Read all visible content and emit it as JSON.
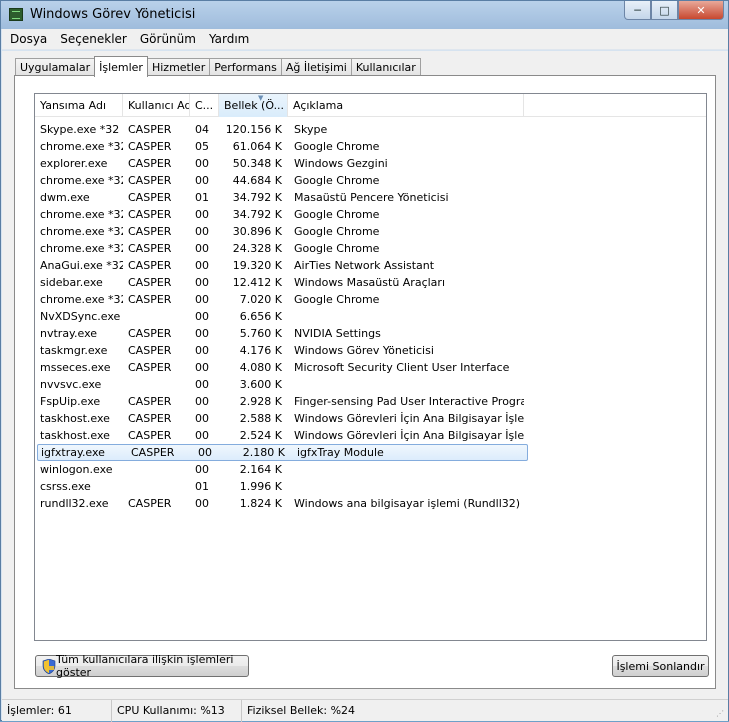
{
  "window": {
    "title": "Windows Görev Yöneticisi"
  },
  "caption_buttons": {
    "minimize": "─",
    "maximize": "□",
    "close": "✕"
  },
  "menu": [
    "Dosya",
    "Seçenekler",
    "Görünüm",
    "Yardım"
  ],
  "tabs": [
    "Uygulamalar",
    "İşlemler",
    "Hizmetler",
    "Performans",
    "Ağ İletişimi",
    "Kullanıcılar"
  ],
  "active_tab": "İşlemler",
  "columns": [
    "Yansıma Adı",
    "Kullanıcı Adı",
    "C...",
    "Bellek (Ö...",
    "Açıklama"
  ],
  "sorted_column": "Bellek (Ö...",
  "processes": [
    {
      "name": "Skype.exe *32",
      "user": "CASPER",
      "cpu": "04",
      "mem": "120.156 K",
      "desc": "Skype"
    },
    {
      "name": "chrome.exe *32",
      "user": "CASPER",
      "cpu": "05",
      "mem": "61.064 K",
      "desc": "Google Chrome"
    },
    {
      "name": "explorer.exe",
      "user": "CASPER",
      "cpu": "00",
      "mem": "50.348 K",
      "desc": "Windows Gezgini"
    },
    {
      "name": "chrome.exe *32",
      "user": "CASPER",
      "cpu": "00",
      "mem": "44.684 K",
      "desc": "Google Chrome"
    },
    {
      "name": "dwm.exe",
      "user": "CASPER",
      "cpu": "01",
      "mem": "34.792 K",
      "desc": "Masaüstü Pencere Yöneticisi"
    },
    {
      "name": "chrome.exe *32",
      "user": "CASPER",
      "cpu": "00",
      "mem": "34.792 K",
      "desc": "Google Chrome"
    },
    {
      "name": "chrome.exe *32",
      "user": "CASPER",
      "cpu": "00",
      "mem": "30.896 K",
      "desc": "Google Chrome"
    },
    {
      "name": "chrome.exe *32",
      "user": "CASPER",
      "cpu": "00",
      "mem": "24.328 K",
      "desc": "Google Chrome"
    },
    {
      "name": "AnaGui.exe *32",
      "user": "CASPER",
      "cpu": "00",
      "mem": "19.320 K",
      "desc": "AirTies Network Assistant"
    },
    {
      "name": "sidebar.exe",
      "user": "CASPER",
      "cpu": "00",
      "mem": "12.412 K",
      "desc": "Windows Masaüstü Araçları"
    },
    {
      "name": "chrome.exe *32",
      "user": "CASPER",
      "cpu": "00",
      "mem": "7.020 K",
      "desc": "Google Chrome"
    },
    {
      "name": "NvXDSync.exe",
      "user": "",
      "cpu": "00",
      "mem": "6.656 K",
      "desc": ""
    },
    {
      "name": "nvtray.exe",
      "user": "CASPER",
      "cpu": "00",
      "mem": "5.760 K",
      "desc": "NVIDIA Settings"
    },
    {
      "name": "taskmgr.exe",
      "user": "CASPER",
      "cpu": "00",
      "mem": "4.176 K",
      "desc": "Windows Görev Yöneticisi"
    },
    {
      "name": "msseces.exe",
      "user": "CASPER",
      "cpu": "00",
      "mem": "4.080 K",
      "desc": "Microsoft Security Client User Interface"
    },
    {
      "name": "nvvsvc.exe",
      "user": "",
      "cpu": "00",
      "mem": "3.600 K",
      "desc": ""
    },
    {
      "name": "FspUip.exe",
      "user": "CASPER",
      "cpu": "00",
      "mem": "2.928 K",
      "desc": "Finger-sensing Pad User Interactive Program"
    },
    {
      "name": "taskhost.exe",
      "user": "CASPER",
      "cpu": "00",
      "mem": "2.588 K",
      "desc": "Windows Görevleri İçin Ana Bilgisayar İşlemi"
    },
    {
      "name": "taskhost.exe",
      "user": "CASPER",
      "cpu": "00",
      "mem": "2.524 K",
      "desc": "Windows Görevleri İçin Ana Bilgisayar İşlemi"
    },
    {
      "name": "igfxtray.exe",
      "user": "CASPER",
      "cpu": "00",
      "mem": "2.180 K",
      "desc": "igfxTray Module",
      "selected": true
    },
    {
      "name": "winlogon.exe",
      "user": "",
      "cpu": "00",
      "mem": "2.164 K",
      "desc": ""
    },
    {
      "name": "csrss.exe",
      "user": "",
      "cpu": "01",
      "mem": "1.996 K",
      "desc": ""
    },
    {
      "name": "rundll32.exe",
      "user": "CASPER",
      "cpu": "00",
      "mem": "1.824 K",
      "desc": "Windows ana bilgisayar işlemi (Rundll32)"
    }
  ],
  "buttons": {
    "show_all": "Tüm kullanıcılara ilişkin işlemleri göster",
    "end_process": "İşlemi Sonlandır"
  },
  "status": {
    "processes": "İşlemler: 61",
    "cpu": "CPU Kullanımı: %13",
    "memory": "Fiziksel Bellek: %24"
  }
}
